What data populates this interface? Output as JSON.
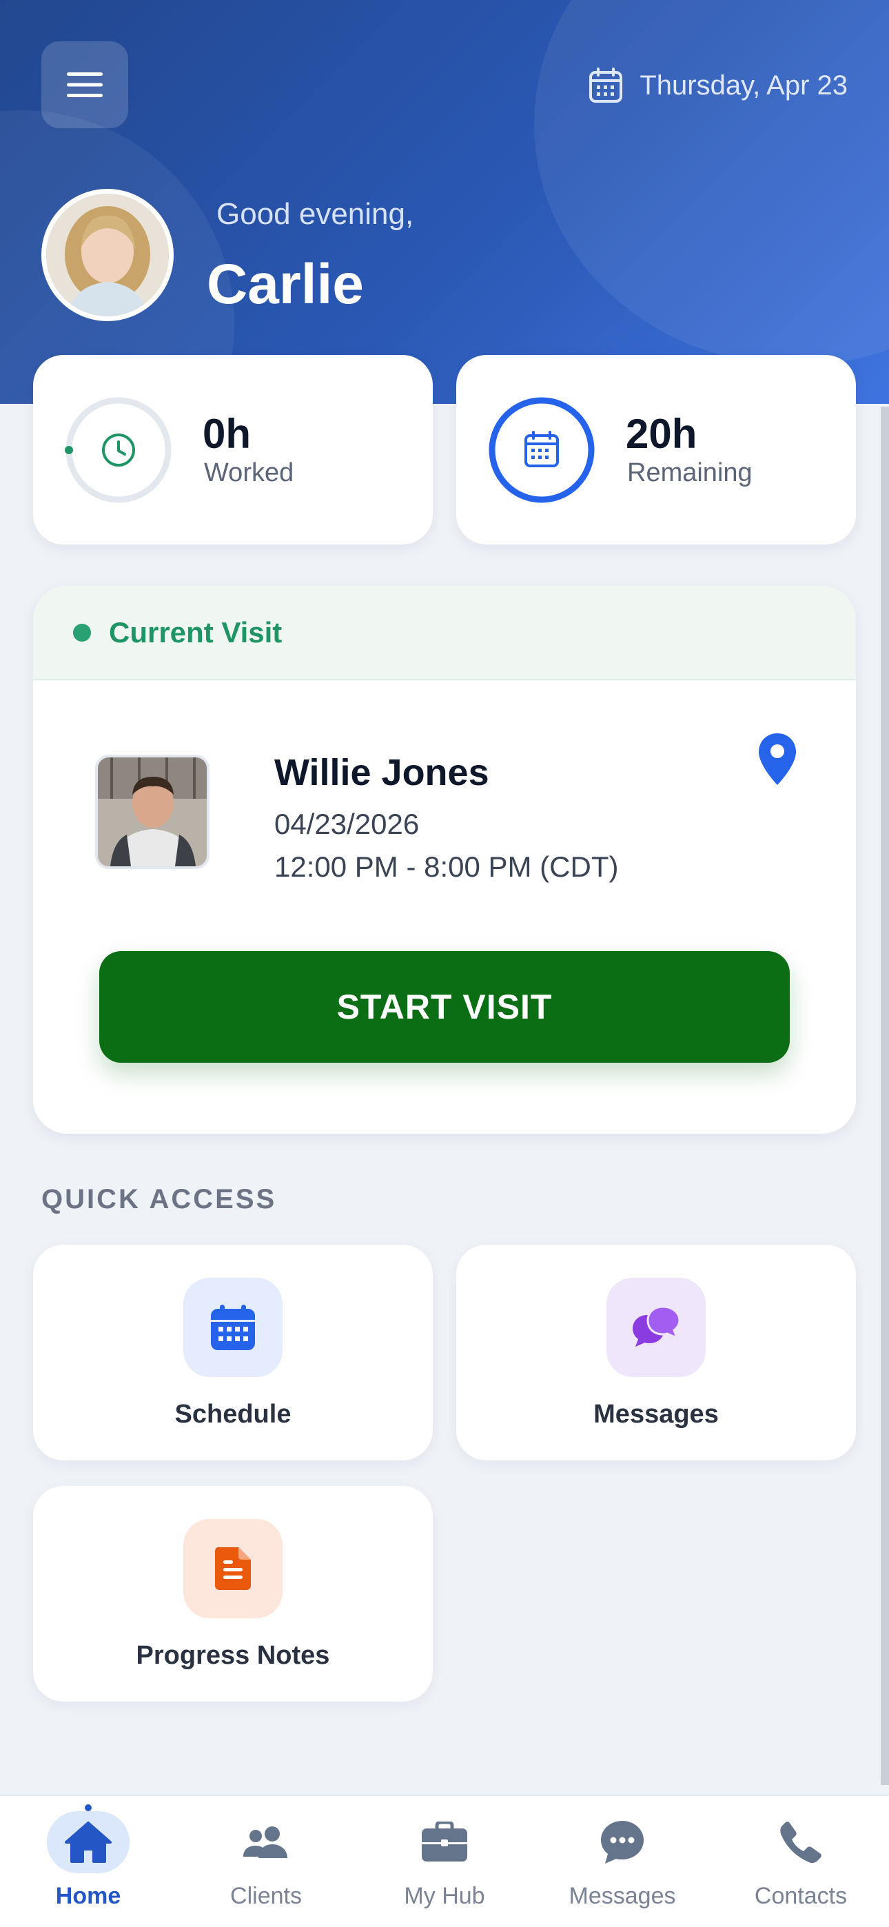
{
  "header": {
    "date": "Thursday, Apr 23",
    "greeting": "Good evening,",
    "user_name": "Carlie"
  },
  "stats": [
    {
      "value": "0h",
      "label": "Worked",
      "color": "#1f9565"
    },
    {
      "value": "20h",
      "label": "Remaining",
      "color": "#2563eb"
    }
  ],
  "current_visit": {
    "section_label": "Current Visit",
    "client_name": "Willie Jones",
    "date": "04/23/2026",
    "time": "12:00 PM - 8:00 PM (CDT)",
    "start_label": "START VISIT"
  },
  "quick_access": {
    "title": "QUICK ACCESS",
    "tiles": [
      {
        "label": "Schedule",
        "icon": "calendar-icon",
        "color": "#2563eb"
      },
      {
        "label": "Messages",
        "icon": "chat-bubbles-icon",
        "color": "#8b3ce0"
      },
      {
        "label": "Progress Notes",
        "icon": "document-icon",
        "color": "#ea580c"
      }
    ]
  },
  "nav": {
    "items": [
      {
        "label": "Home",
        "icon": "home-icon",
        "active": true
      },
      {
        "label": "Clients",
        "icon": "users-icon",
        "active": false
      },
      {
        "label": "My Hub",
        "icon": "briefcase-icon",
        "active": false
      },
      {
        "label": "Messages",
        "icon": "chat-icon",
        "active": false
      },
      {
        "label": "Contacts",
        "icon": "phone-icon",
        "active": false
      }
    ]
  }
}
